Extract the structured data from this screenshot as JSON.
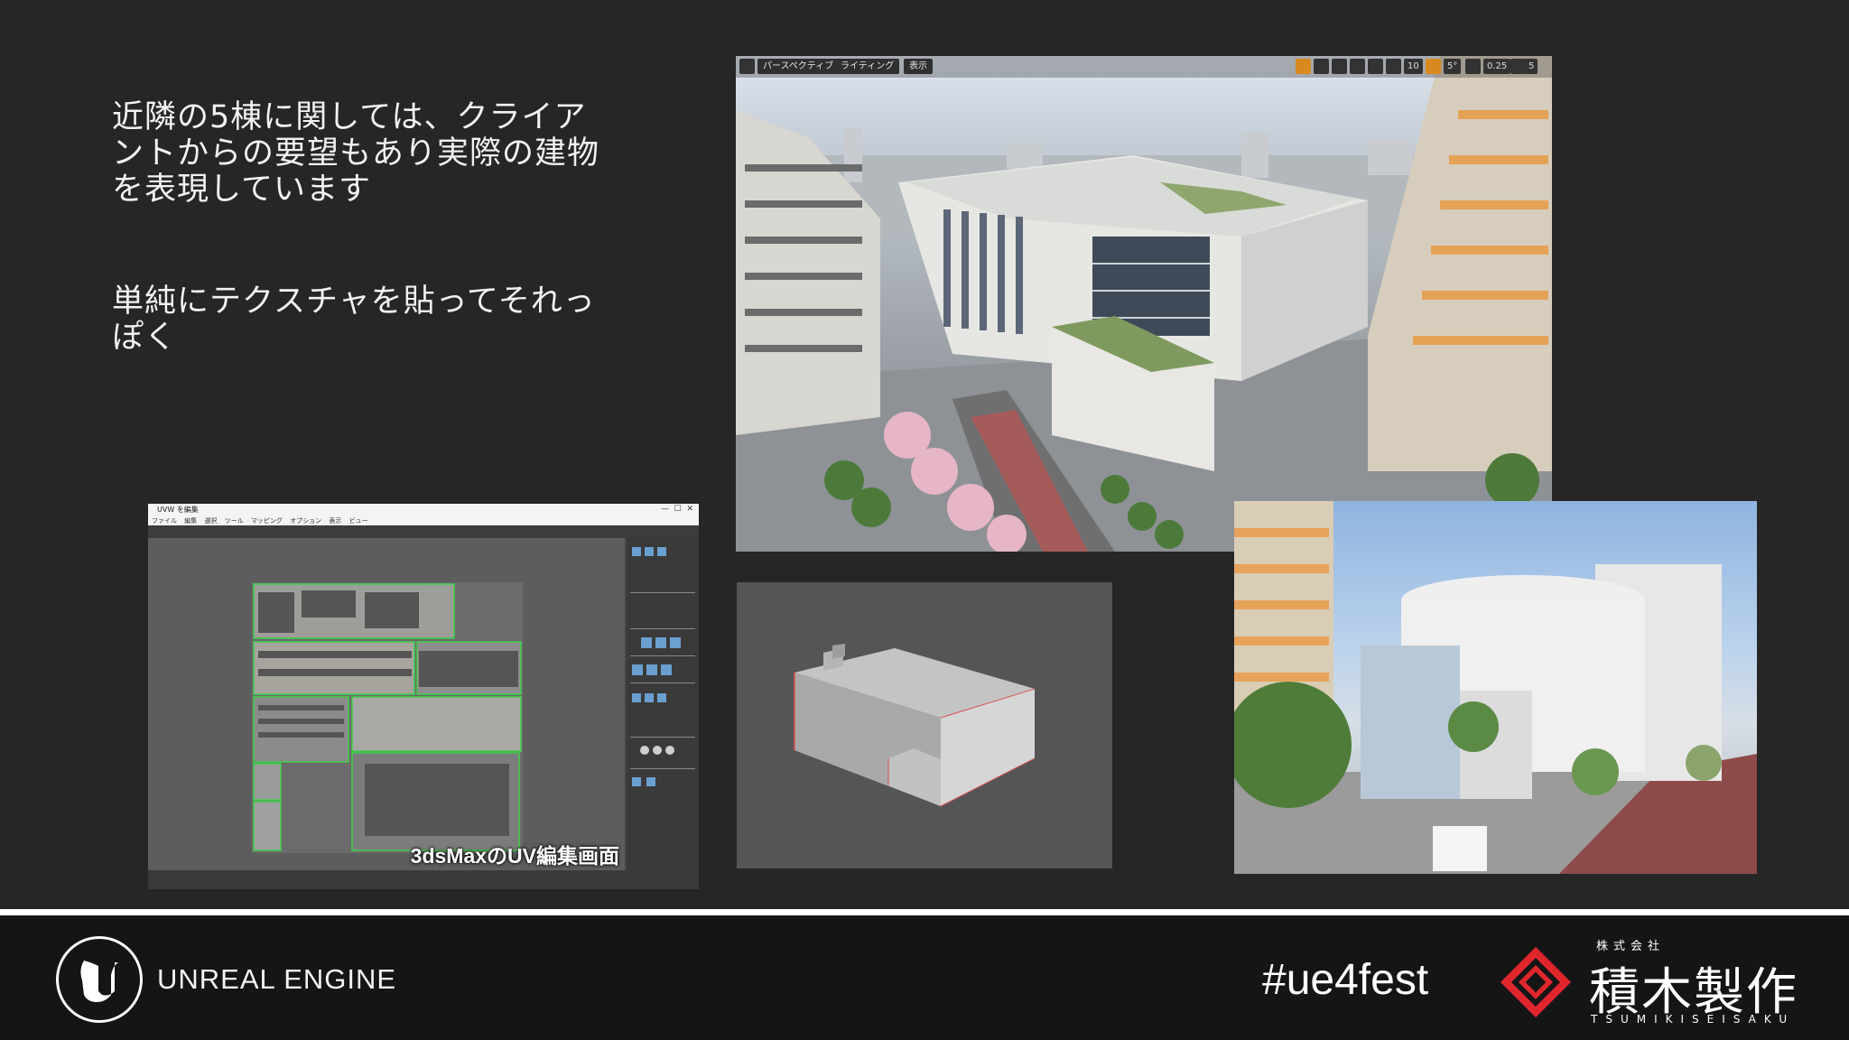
{
  "slide": {
    "para1": "近隣の5棟に関しては、クライア\nントからの要望もあり実際の建物\nを表現しています",
    "para2": "単純にテクスチャを貼ってそれっ\nぽく"
  },
  "viewport": {
    "perspective_label": "パースペクティブ",
    "lighting_label": "ライティング",
    "show_label": "表示",
    "grid_value": "10",
    "angle_value": "5°",
    "scale_value": "0.25",
    "camera_speed": "5"
  },
  "max_window": {
    "title": "UVW を編集",
    "menu": [
      "ファイル",
      "編集",
      "選択",
      "ツール",
      "マッピング",
      "オプション",
      "表示",
      "ビュー"
    ],
    "caption": "3dsMaxのUV編集画面"
  },
  "footer": {
    "engine_label": "UNREAL ENGINE",
    "hashtag": "#ue4fest",
    "company_small": "株式会社",
    "company_name": "積木製作",
    "company_roman": "TSUMIKISEISAKU"
  },
  "colors": {
    "background": "#262626",
    "footer": "#151515",
    "accent_red": "#e0262d"
  }
}
